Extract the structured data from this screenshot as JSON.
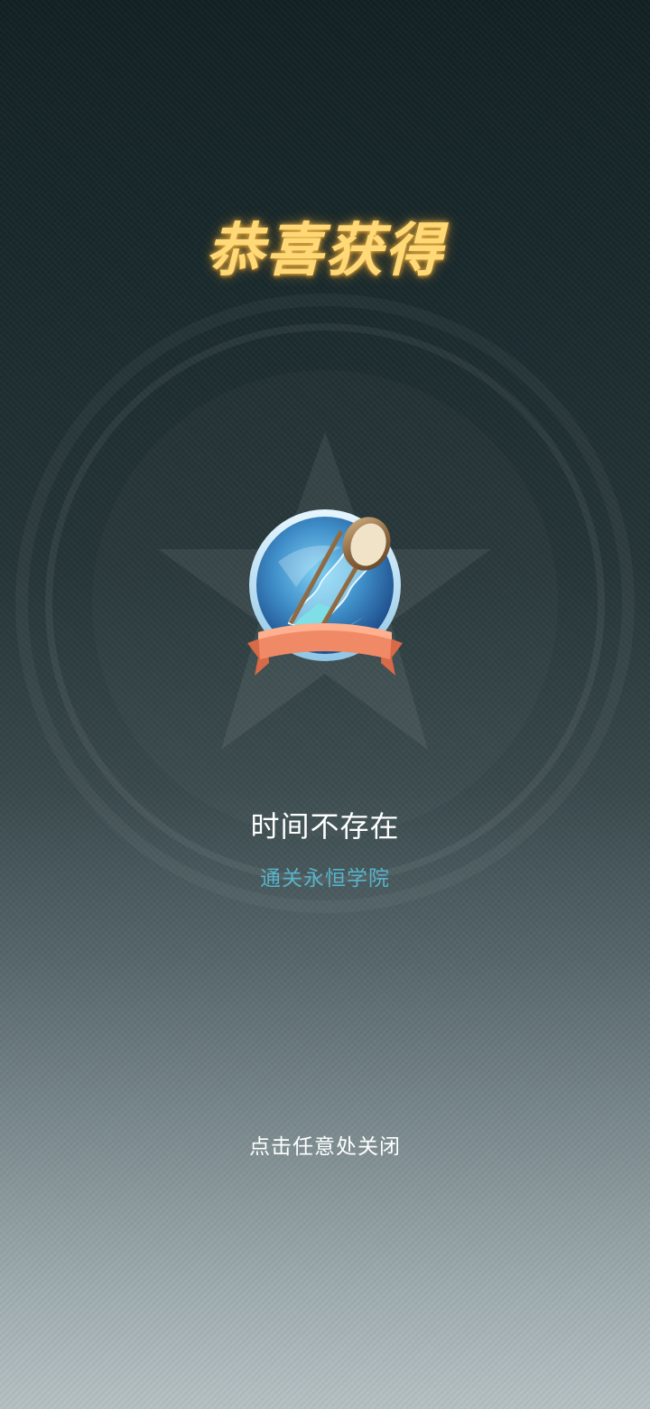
{
  "dialog": {
    "title": "恭喜获得",
    "badge": {
      "name": "时间不存在",
      "source": "通关永恒学院",
      "icon": "hourglass-icon"
    },
    "close_hint": "点击任意处关闭"
  },
  "colors": {
    "title": "#ffd877",
    "source": "#58b3cb",
    "ribbon": "#f08a66"
  }
}
